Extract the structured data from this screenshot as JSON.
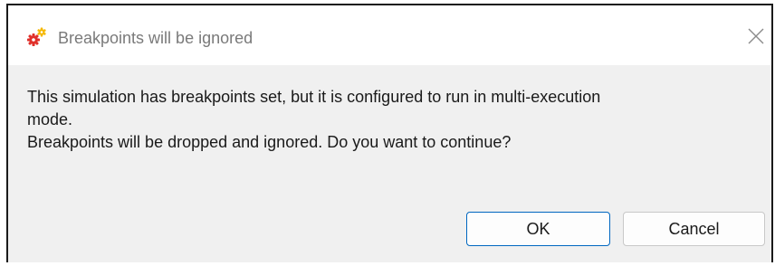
{
  "dialog": {
    "title": "Breakpoints will be ignored",
    "app_icon": "gears-icon",
    "close_icon": "close-icon",
    "message_lines": [
      "This simulation has breakpoints set, but it is configured to run in multi-execution",
      "mode.",
      "Breakpoints will be dropped and ignored. Do you want to continue?"
    ],
    "ok_label": "OK",
    "cancel_label": "Cancel"
  },
  "colors": {
    "accent": "#0067c0",
    "gear_red": "#e0302a",
    "gear_yellow": "#f5b800",
    "dialog_bg": "#f0f0f0"
  }
}
